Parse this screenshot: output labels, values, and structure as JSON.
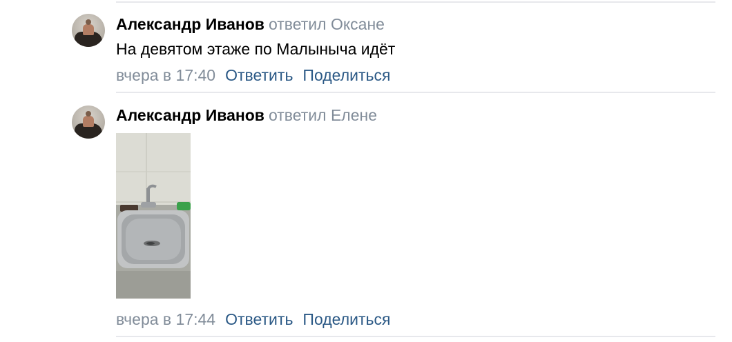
{
  "comments": [
    {
      "author": "Александр Иванов",
      "reply_to": "ответил Оксане",
      "text": "На девятом этаже по Малыныча идёт",
      "time": "вчера в 17:40",
      "reply_label": "Ответить",
      "share_label": "Поделиться"
    },
    {
      "author": "Александр Иванов",
      "reply_to": "ответил Елене",
      "attachment": "photo",
      "time": "вчера в 17:44",
      "reply_label": "Ответить",
      "share_label": "Поделиться"
    }
  ],
  "colors": {
    "author": "#000000",
    "secondary": "#818c99",
    "link": "#2a5885",
    "divider": "#e7e8ec"
  },
  "icons": {
    "avatar": "user-avatar-photo",
    "attachment": "photo-sink-faucet"
  }
}
